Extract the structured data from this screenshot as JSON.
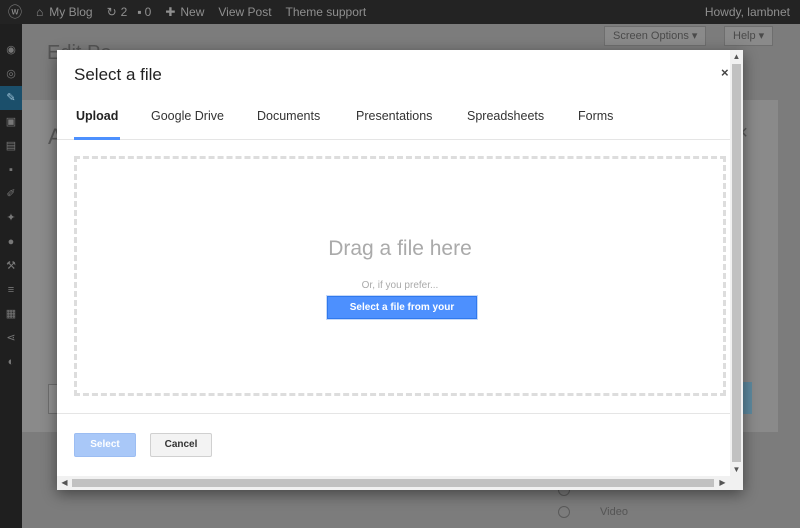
{
  "adminbar": {
    "site_name": "My Blog",
    "comments_count": "2",
    "comments_pending": "0",
    "new_label": "New",
    "view_post": "View Post",
    "theme_support": "Theme support",
    "howdy": "Howdy, lambnet"
  },
  "background": {
    "page_title": "Edit Po",
    "screen_options": "Screen Options ▾",
    "help": "Help ▾",
    "modal_title": "A",
    "modal_close": "×",
    "radio_label": "Video"
  },
  "dialog": {
    "title": "Select a file",
    "close": "×",
    "tabs": [
      {
        "label": "Upload",
        "active": true
      },
      {
        "label": "Google Drive",
        "active": false
      },
      {
        "label": "Documents",
        "active": false
      },
      {
        "label": "Presentations",
        "active": false
      },
      {
        "label": "Spreadsheets",
        "active": false
      },
      {
        "label": "Forms",
        "active": false
      }
    ],
    "drag_text": "Drag a file here",
    "prefer_text": "Or, if you prefer...",
    "select_from_computer": "Select a file from your computer",
    "select_button": "Select",
    "cancel_button": "Cancel"
  },
  "colors": {
    "accent": "#4d90fe",
    "accent_disabled": "#a9c8f8",
    "admin_bar": "#232323"
  },
  "icons": {
    "wordpress": "wordpress-logo-icon",
    "home": "home-icon",
    "comments": "comment-bubble-icon",
    "new": "plus-icon",
    "close": "close-icon",
    "scroll_up": "triangle-up-icon",
    "scroll_down": "triangle-down-icon",
    "scroll_left": "triangle-left-icon",
    "scroll_right": "triangle-right-icon"
  }
}
